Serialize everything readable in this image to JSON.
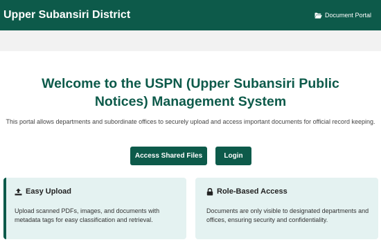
{
  "header": {
    "brand": "Upper Subansiri District",
    "portal_link": "Document Portal"
  },
  "hero": {
    "title": "Welcome to the USPN (Upper Subansiri Public Notices) Management System",
    "description": "This portal allows departments and subordinate offices to securely upload and access important documents for official record keeping."
  },
  "buttons": {
    "shared_files": "Access Shared Files",
    "login": "Login"
  },
  "features": [
    {
      "icon": "upload-icon",
      "title": "Easy Upload",
      "text": "Upload scanned PDFs, images, and documents with metadata tags for easy classification and retrieval."
    },
    {
      "icon": "lock-icon",
      "title": "Role-Based Access",
      "text": "Documents are only visible to designated departments and offices, ensuring security and confidentiality."
    }
  ],
  "colors": {
    "primary": "#0d5a4a",
    "card_bg": "#e4f2f1"
  }
}
